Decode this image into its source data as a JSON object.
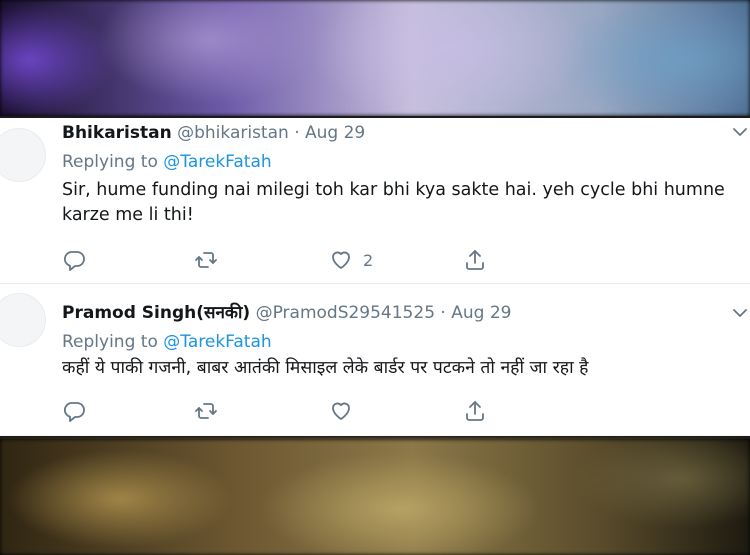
{
  "tweets": [
    {
      "name": "Bhikaristan",
      "handle": "@bhikaristan",
      "separator": "·",
      "date": "Aug 29",
      "replying_label": "Replying to",
      "replying_to": "@TarekFatah",
      "text": "Sir, hume funding nai milegi toh kar bhi kya sakte hai. yeh cycle bhi humne karze me li thi!",
      "likes": "2"
    },
    {
      "name": "Pramod Singh(सनकी)",
      "handle": "@PramodS29541525",
      "separator": "·",
      "date": "Aug 29",
      "replying_label": "Replying to",
      "replying_to": "@TarekFatah",
      "text": "कहीं ये पाकी गजनी, बाबर आतंकी मिसाइल लेके बार्डर पर पटकने तो नहीं जा रहा है",
      "likes": ""
    }
  ],
  "icons": {
    "reply": "reply-icon",
    "retweet": "retweet-icon",
    "like": "heart-icon",
    "share": "share-icon",
    "menu": "chevron-down-icon"
  },
  "colors": {
    "text": "#14171a",
    "secondary": "#657786",
    "link": "#1b95e0"
  }
}
